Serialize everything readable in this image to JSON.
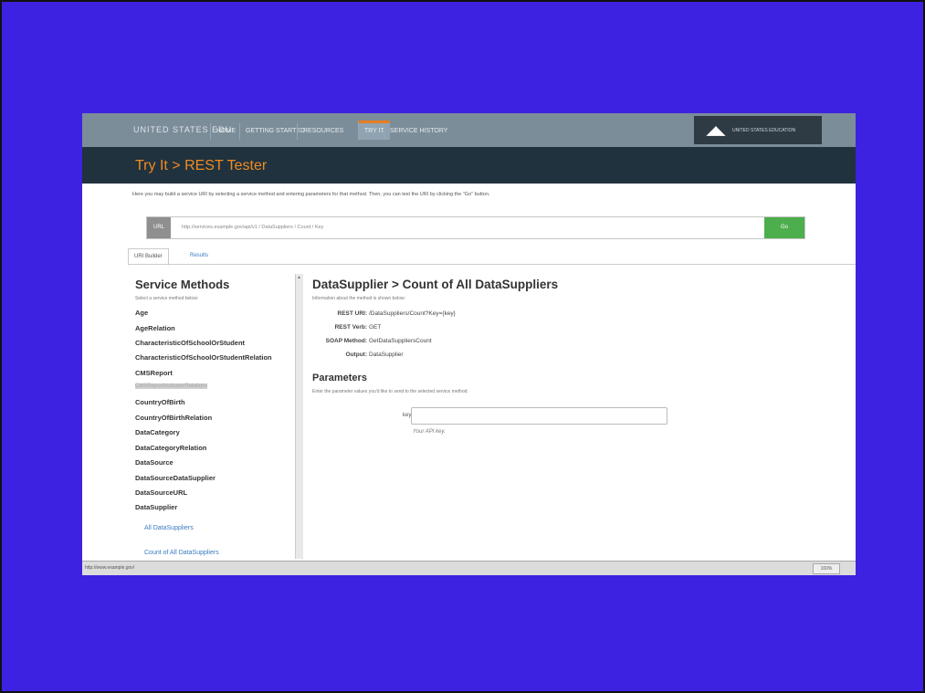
{
  "nav": {
    "brand": "UNITED STATES EDU",
    "tabs": [
      "HOME",
      "GETTING STARTED",
      "RESOURCES",
      "TRY IT",
      "SERVICE HISTORY"
    ],
    "active_tab": "TRY IT",
    "logo_text": "UNITED STATES EDUCATION"
  },
  "page": {
    "title": "Try It > REST Tester",
    "intro": "Here you may build a service URI by selecting a service method and entering parameters for that method. Then, you can test the URI by clicking the \"Go\" button."
  },
  "urlbar": {
    "label": "URL",
    "value": "http://services.example.gov/api/v1 / DataSuppliers / Count / Key",
    "go": "Go"
  },
  "tabs": {
    "builder": "URI Builder",
    "results": "Results"
  },
  "sidebar": {
    "title": "Service Methods",
    "subtitle": "Select a service method below:",
    "items": [
      "Age",
      "AgeRelation",
      "CharacteristicOfSchoolOrStudent",
      "CharacteristicOfSchoolOrStudentRelation",
      "CMSReport",
      "CMSReportIndicatorRelations",
      "CountryOfBirth",
      "CountryOfBirthRelation",
      "DataCategory",
      "DataCategoryRelation",
      "DataSource",
      "DataSourceDataSupplier",
      "DataSourceURL",
      "DataSupplier"
    ],
    "selected_index": 5,
    "sub_items": [
      "All DataSuppliers",
      "Count of All DataSuppliers"
    ]
  },
  "main": {
    "title": "DataSupplier > Count of All DataSuppliers",
    "subtitle": "Information about the method is shown below:",
    "rest_uri_label": "REST URI:",
    "rest_uri": "/DataSuppliers/Count?Key={key}",
    "rest_verb_label": "REST Verb:",
    "rest_verb": "GET",
    "soap_label": "SOAP Method:",
    "soap": "GetDataSuppliersCount",
    "output_label": "Output:",
    "output": "DataSupplier",
    "params_title": "Parameters",
    "params_sub": "Enter the parameter values you'd like to send to the selected service method:",
    "key_label": "key:",
    "key_help": "Your API key."
  },
  "status": {
    "left": "http://www.example.gov/",
    "zoom": "100%"
  }
}
